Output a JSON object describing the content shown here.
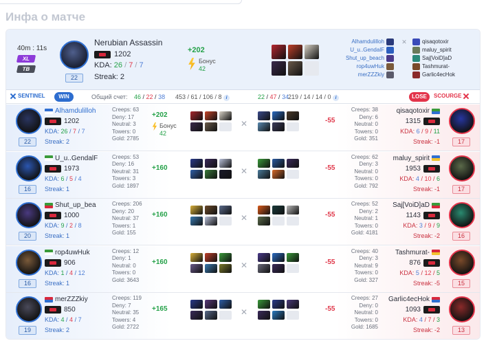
{
  "section_title": "Инфа о матче",
  "header": {
    "duration": "40m : 11s",
    "badge_xl": "XL",
    "badge_tb": "TB",
    "level": "22",
    "hero_name": "Nerubian Assassin",
    "mmr": "1202",
    "kda_label": "KDA:",
    "kda": {
      "k": "26",
      "d": "7",
      "a": "7"
    },
    "streak": "Streak: 2",
    "score": "+202",
    "bonus_label": "Бонус",
    "bonus_value": "42",
    "items": [
      "#b5272f",
      "#c0402a",
      "#d8d2c6",
      "#3a2a4a",
      "#6b5b4a",
      "#e6e9ef"
    ],
    "radiant_roster": [
      {
        "name": "Alhamdulilloh",
        "color": "#2a3a7a"
      },
      {
        "name": "U_u..GendalF",
        "color": "#2c5fbf"
      },
      {
        "name": "Shut_up_beach",
        "color": "#4a3a8a"
      },
      {
        "name": "rop4uwHuk",
        "color": "#7a5a3a"
      },
      {
        "name": "merZZZkiy",
        "color": "#5a5a6a"
      }
    ],
    "dire_roster": [
      {
        "name": "qisaqotoxir",
        "color": "#3a4ab8"
      },
      {
        "name": "maluy_spirit",
        "color": "#6a7a5a"
      },
      {
        "name": "Saj[VoiD]aD",
        "color": "#2a8a7a"
      },
      {
        "name": "Tashmurat-",
        "color": "#7a4a2a"
      },
      {
        "name": "Garlic4ecHok",
        "color": "#8a2a2a"
      }
    ]
  },
  "score_bar": {
    "sentinel": "SENTINEL",
    "win": "WIN",
    "total_label": "Общий счет:",
    "rad_k": "46",
    "rad_d": "22",
    "rad_a": "38",
    "rad_net": "453 / 61 / 106 / 8",
    "dire_k": "22",
    "dire_d": "47",
    "dire_a": "34",
    "dire_net": "219 / 14 / 14 / 0",
    "lose": "LOSE",
    "scourge": "SCOURGE",
    "info": "i"
  },
  "rows": [
    {
      "rad": {
        "name": "Alhamdulilloh",
        "mmr": "1202",
        "k": "26",
        "d": "7",
        "a": "7",
        "streak": "Streak: 2",
        "level": "22",
        "avatar": "#2a3560",
        "stats": [
          "Creeps: 63",
          "Deny: 17",
          "Neutral: 3",
          "Towers: 0",
          "Gold: 2785"
        ],
        "score": "+202",
        "bonus": "Бонус",
        "bonus_value": "42",
        "items": [
          "#a7262d",
          "#c6452a",
          "#d8d2c6",
          "#3a2a4a",
          "#6b5b4a",
          "#e6e9ef"
        ]
      },
      "dire": {
        "name": "qisaqotoxir",
        "mmr": "1315",
        "k": "6",
        "d": "9",
        "a": "11",
        "streak": "Streak: -1",
        "level": "17",
        "avatar": "#2736a0",
        "stats": [
          "Creeps: 38",
          "Deny: 6",
          "Neutral: 0",
          "Towers: 0",
          "Gold: 351"
        ],
        "score": "-55",
        "items": [
          "#3a4a8a",
          "#2a6ac0",
          "#4a3a2a",
          "#5a8ab0",
          "#3a3a5a",
          "#e6e9ef"
        ]
      }
    },
    {
      "rad": {
        "name": "U_u..GendalF",
        "mmr": "1973",
        "k": "6",
        "d": "5",
        "a": "4",
        "streak": "Streak: 1",
        "level": "16",
        "avatar": "#2b56b0",
        "stats": [
          "Creeps: 53",
          "Deny: 16",
          "Neutral: 31",
          "Towers: 3",
          "Gold: 1897"
        ],
        "score": "+160",
        "items": [
          "#2a3a8a",
          "#3a2a5a",
          "#b8c0d8",
          "#2f5fa8",
          "#3a7a3a",
          "#1a1a2a"
        ]
      },
      "dire": {
        "name": "maluy_spirit",
        "mmr": "1953",
        "k": "4",
        "d": "10",
        "a": "6",
        "streak": "Streak: -1",
        "level": "17",
        "avatar": "#5b6a4a",
        "stats": [
          "Creeps: 62",
          "Deny: 3",
          "Neutral: 0",
          "Towers: 0",
          "Gold: 792"
        ],
        "score": "-55",
        "items": [
          "#3a9a3a",
          "#2a5aa0",
          "#3a2a5a",
          "#4a7a9a",
          "#d86a2a",
          "#e6e9ef"
        ]
      }
    },
    {
      "rad": {
        "name": "Shut_up_bea",
        "mmr": "1000",
        "k": "9",
        "d": "2",
        "a": "8",
        "streak": "Streak: 1",
        "level": "20",
        "avatar": "#4a3a80",
        "stats": [
          "Creeps: 206",
          "Deny: 20",
          "Neutral: 37",
          "Towers: 1",
          "Gold: 155"
        ],
        "score": "+160",
        "items": [
          "#d8b03a",
          "#6a4a2a",
          "#5a6a8a",
          "#3a7ab0",
          "#b8c0d8",
          "#e6e9ef"
        ]
      },
      "dire": {
        "name": "Saj[VoiD]aD",
        "mmr": "1143",
        "k": "3",
        "d": "9",
        "a": "9",
        "streak": "Streak: -2",
        "level": "16",
        "avatar": "#2a8a70",
        "stats": [
          "Creeps: 52",
          "Deny: 2",
          "Neutral: 1",
          "Towers: 0",
          "Gold: 4181"
        ],
        "score": "-55",
        "items": [
          "#d85a1a",
          "#1a3a3a",
          "#b8b8b8",
          "#5a6a4a",
          "#e6e9ef",
          "#e6e9ef"
        ]
      }
    },
    {
      "rad": {
        "name": "rop4uwHuk",
        "mmr": "906",
        "k": "1",
        "d": "4",
        "a": "12",
        "streak": "Streak: 1",
        "level": "16",
        "avatar": "#7a5a3a",
        "stats": [
          "Creeps: 12",
          "Deny: 1",
          "Neutral: 0",
          "Towers: 0",
          "Gold: 3643"
        ],
        "score": "+160",
        "items": [
          "#d8b03a",
          "#c0402a",
          "#3a9a3a",
          "#6a5a8a",
          "#3a7ab0",
          "#7a7a2a"
        ]
      },
      "dire": {
        "name": "Tashmurat-",
        "mmr": "876",
        "k": "5",
        "d": "12",
        "a": "5",
        "streak": "Streak: -5",
        "level": "15",
        "avatar": "#7a4a2a",
        "stats": [
          "Creeps: 40",
          "Deny: 3",
          "Neutral: 9",
          "Towers: 0",
          "Gold: 327"
        ],
        "score": "-55",
        "items": [
          "#4a3a8a",
          "#2a6ac0",
          "#3a9a3a",
          "#6a6a7a",
          "#3a2a5a",
          "#e6e9ef"
        ]
      }
    },
    {
      "rad": {
        "name": "merZZZkiy",
        "mmr": "850",
        "k": "4",
        "d": "4",
        "a": "7",
        "streak": "Streak: 2",
        "level": "19",
        "avatar": "#4a4a5a",
        "stats": [
          "Creeps: 119",
          "Deny: 7",
          "Neutral: 35",
          "Towers: 4",
          "Gold: 2722"
        ],
        "score": "+165",
        "items": [
          "#2a3a8a",
          "#5a3a7a",
          "#2f5fa8",
          "#3a2a5a",
          "#5a6a8a",
          "#e6e9ef"
        ]
      },
      "dire": {
        "name": "Garlic4ecHok",
        "mmr": "1093",
        "k": "4",
        "d": "7",
        "a": "3",
        "streak": "Streak: -2",
        "level": "13",
        "avatar": "#8a2a2a",
        "stats": [
          "Creeps: 27",
          "Deny: 0",
          "Neutral: 0",
          "Towers: 0",
          "Gold: 1685"
        ],
        "score": "-55",
        "items": [
          "#3a9a3a",
          "#2a3a8a",
          "#4a3a7a",
          "#3a2a5a",
          "#2a7ac0",
          "#e6e9ef"
        ]
      }
    }
  ]
}
